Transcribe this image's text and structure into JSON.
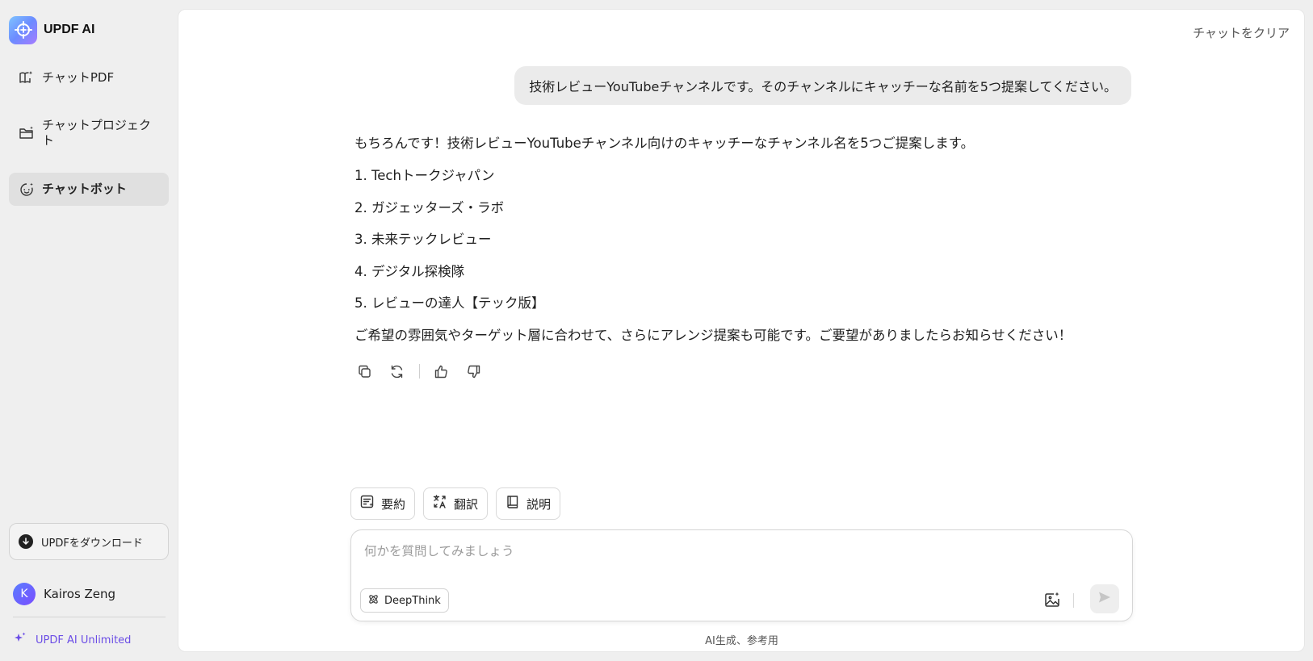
{
  "brand": {
    "name": "UPDF AI"
  },
  "sidebar": {
    "items": [
      {
        "label": "チャットPDF",
        "icon": "book-ai-icon"
      },
      {
        "label": "チャットプロジェクト",
        "icon": "folder-icon"
      },
      {
        "label": "チャットボット",
        "icon": "bot-icon",
        "active": true
      }
    ],
    "download_label": "UPDFをダウンロード",
    "user": {
      "initial": "K",
      "name": "Kairos Zeng"
    },
    "unlimited_label": "UPDF AI Unlimited"
  },
  "header": {
    "clear_label": "チャットをクリア"
  },
  "conversation": {
    "user_message": "技術レビューYouTubeチャンネルです。そのチャンネルにキャッチーな名前を5つ提案してください。",
    "answer": {
      "intro": "もちろんです！技術レビューYouTubeチャンネル向けのキャッチーなチャンネル名を5つご提案します。",
      "items": [
        "1.  Techトークジャパン",
        "2. ガジェッターズ・ラボ",
        "3. 未来テックレビュー",
        "4. デジタル探検隊",
        "5. レビューの達人【テック版】"
      ],
      "outro": "ご希望の雰囲気やターゲット層に合わせて、さらにアレンジ提案も可能です。ご要望がありましたらお知らせください！"
    }
  },
  "quick_actions": [
    {
      "label": "要約",
      "icon": "summary-icon"
    },
    {
      "label": "翻訳",
      "icon": "translate-icon"
    },
    {
      "label": "説明",
      "icon": "book-icon"
    }
  ],
  "composer": {
    "placeholder": "何かを質問してみましょう",
    "value": "",
    "deepthink_label": "DeepThink"
  },
  "footer": {
    "disclaimer": "AI生成、参考用"
  },
  "colors": {
    "accent": "#6b4de6",
    "active_nav": "#e0e0e0"
  }
}
